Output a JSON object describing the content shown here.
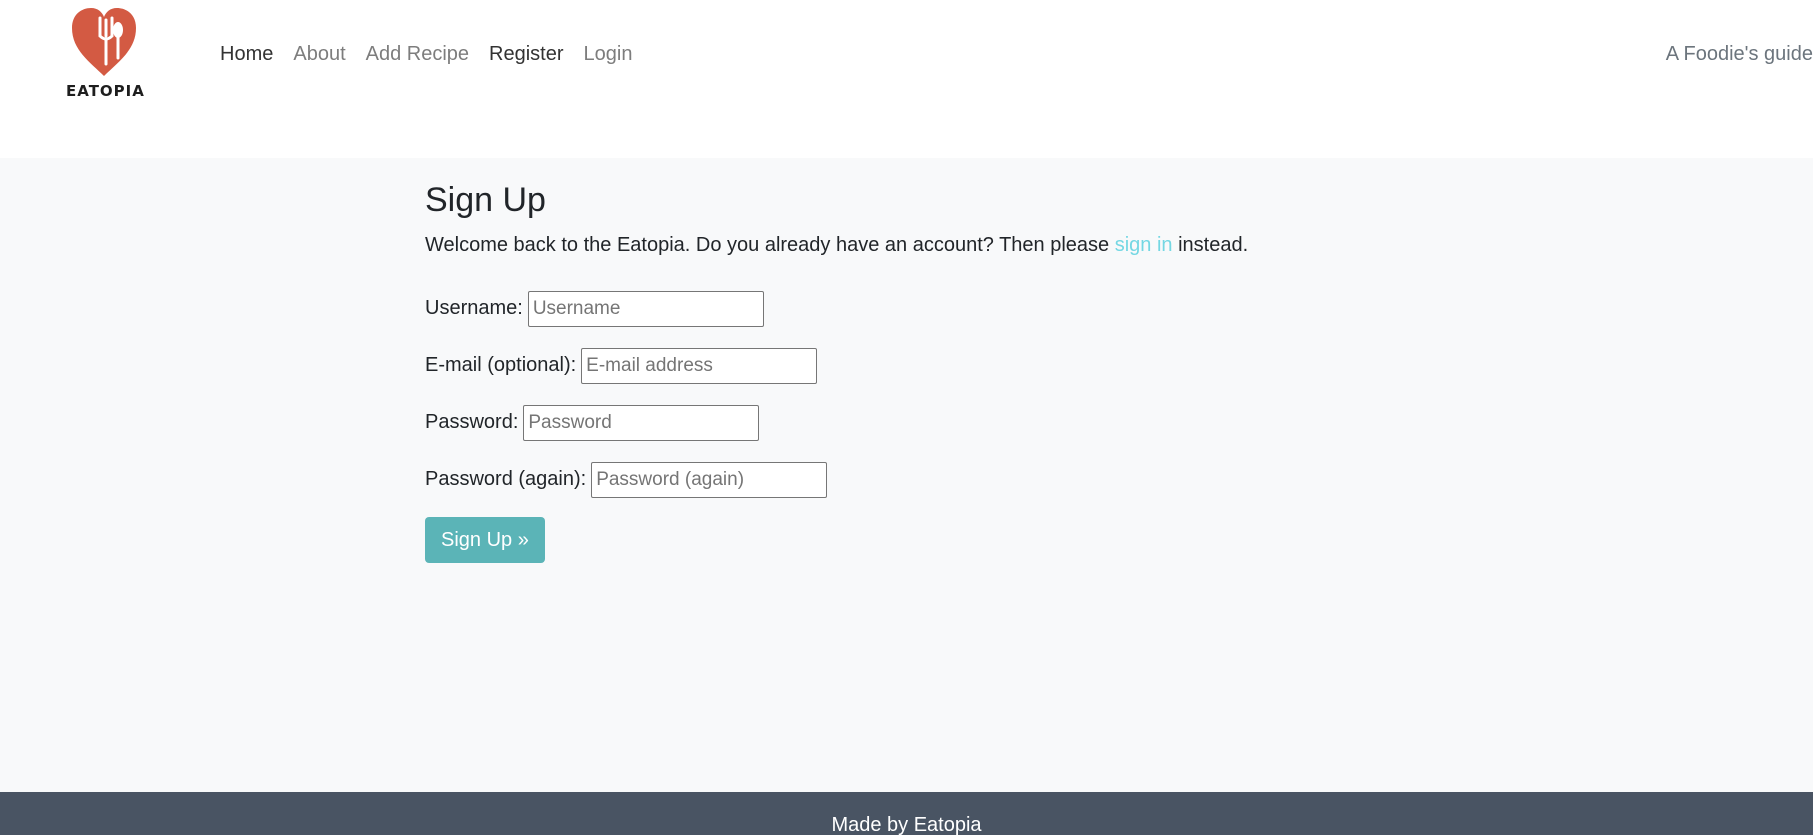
{
  "brand": {
    "name": "EATOPIA",
    "icon": "heart-fork-spoon-logo",
    "color": "#d35a43"
  },
  "nav": {
    "links": [
      {
        "label": "Home",
        "active": true
      },
      {
        "label": "About"
      },
      {
        "label": "Add Recipe"
      },
      {
        "label": "Register"
      },
      {
        "label": "Login"
      }
    ],
    "tagline": "A Foodie's guide"
  },
  "page": {
    "title": "Sign Up",
    "intro_before": "Welcome back to the Eatopia. Do you already have an account? Then please ",
    "intro_link": "sign in",
    "intro_after": " instead.",
    "link_color": "#74d7e3"
  },
  "form": {
    "fields": [
      {
        "label": "Username:",
        "placeholder": "Username",
        "value": ""
      },
      {
        "label": "E-mail (optional):",
        "placeholder": "E-mail address",
        "value": ""
      },
      {
        "label": "Password:",
        "placeholder": "Password",
        "value": ""
      },
      {
        "label": "Password (again):",
        "placeholder": "Password (again)",
        "value": ""
      }
    ],
    "submit_label": "Sign Up »",
    "submit_color": "#5bb4b7"
  },
  "footer": {
    "text": "Made by Eatopia",
    "background": "#495463"
  }
}
